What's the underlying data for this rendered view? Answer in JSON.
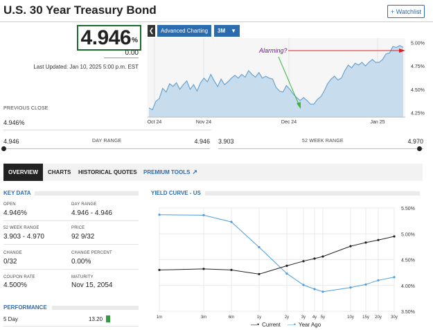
{
  "header": {
    "title": "U.S. 30 Year Treasury Bond",
    "watchlist_label": "+ Watchlist"
  },
  "quote": {
    "price": "4.946",
    "price_unit": "%",
    "change": "0.00",
    "last_updated": "Last Updated: Jan 10, 2025 5:00 p.m. EST"
  },
  "previous_close": {
    "label": "PREVIOUS CLOSE",
    "value": "4.946%"
  },
  "day_range": {
    "label": "DAY RANGE",
    "low": "4.946",
    "high": "4.946",
    "position": 0
  },
  "week52_range": {
    "label": "52 WEEK RANGE",
    "low": "3.903",
    "high": "4.970",
    "position": 0.98
  },
  "chart_controls": {
    "back_icon": "chevron-left-icon",
    "advanced_label": "Advanced Charting",
    "range_label": "3M",
    "dropdown_icon": "caret-down-icon"
  },
  "colors": {
    "accent": "#2b6cb0",
    "price_box_border": "#1a6b2a",
    "area_fill": "#c7dcec",
    "area_line": "#6aa3cf",
    "annotation_red": "#d62020",
    "annotation_green": "#3cb43c",
    "current_series": "#222222",
    "year_ago_series": "#4a9ee0"
  },
  "tabs": [
    {
      "label": "OVERVIEW",
      "active": true
    },
    {
      "label": "CHARTS",
      "active": false
    },
    {
      "label": "HISTORICAL QUOTES",
      "active": false
    },
    {
      "label": "PREMIUM TOOLS",
      "active": false,
      "icon": "external-link-icon"
    }
  ],
  "key_data": {
    "heading": "KEY DATA",
    "items": [
      {
        "label": "OPEN",
        "value": "4.946%"
      },
      {
        "label": "DAY RANGE",
        "value": "4.946 - 4.946"
      },
      {
        "label": "52 WEEK RANGE",
        "value": "3.903 - 4.970"
      },
      {
        "label": "PRICE",
        "value": "92 9/32"
      },
      {
        "label": "CHANGE",
        "value": "0/32"
      },
      {
        "label": "CHANGE PERCENT",
        "value": "0.00%"
      },
      {
        "label": "COUPON RATE",
        "value": "4.500%"
      },
      {
        "label": "MATURITY",
        "value": "Nov 15, 2054"
      }
    ]
  },
  "performance": {
    "heading": "PERFORMANCE",
    "rows": [
      {
        "label": "5 Day",
        "value": "13.20",
        "bar_color": "#2e9e3e"
      }
    ]
  },
  "yield_curve": {
    "heading": "YIELD CURVE - US"
  },
  "chart_data": [
    {
      "type": "area",
      "title": "",
      "x_ticks": [
        "Oct 24",
        "Nov 24",
        "Dec 24",
        "Jan 25"
      ],
      "y_ticks": [
        "4.25%",
        "4.50%",
        "4.75%",
        "5.00%"
      ],
      "ylim": [
        4.2,
        5.05
      ],
      "annotations": [
        {
          "text": "Alarming?",
          "color": "red-arrow-to-peak"
        }
      ],
      "values": [
        4.3,
        4.28,
        4.37,
        4.4,
        4.51,
        4.47,
        4.56,
        4.53,
        4.57,
        4.5,
        4.55,
        4.59,
        4.5,
        4.55,
        4.48,
        4.57,
        4.62,
        4.58,
        4.66,
        4.59,
        4.53,
        4.61,
        4.55,
        4.58,
        4.62,
        4.65,
        4.62,
        4.66,
        4.63,
        4.7,
        4.66,
        4.63,
        4.68,
        4.62,
        4.64,
        4.62,
        4.61,
        4.52,
        4.48,
        4.47,
        4.54,
        4.5,
        4.45,
        4.41,
        4.38,
        4.41,
        4.38,
        4.34,
        4.34,
        4.39,
        4.42,
        4.48,
        4.56,
        4.61,
        4.64,
        4.6,
        4.62,
        4.7,
        4.76,
        4.73,
        4.78,
        4.76,
        4.79,
        4.75,
        4.79,
        4.82,
        4.79,
        4.79,
        4.82,
        4.88,
        4.89,
        4.96,
        4.95,
        4.97,
        4.95
      ]
    },
    {
      "type": "line",
      "title": "",
      "categories": [
        "1m",
        "3m",
        "6m",
        "1y",
        "2y",
        "3y",
        "4y",
        "5y",
        "10y",
        "15y",
        "20y",
        "30y"
      ],
      "y_ticks": [
        "3.50%",
        "4.00%",
        "4.50%",
        "5.00%",
        "5.50%"
      ],
      "ylim": [
        3.5,
        5.5
      ],
      "series": [
        {
          "name": "Current",
          "values": [
            4.3,
            4.32,
            4.3,
            4.22,
            4.38,
            4.47,
            4.52,
            4.56,
            4.76,
            4.83,
            4.88,
            4.95
          ]
        },
        {
          "name": "Year Ago",
          "values": [
            5.37,
            5.36,
            5.23,
            4.74,
            4.23,
            4.01,
            3.93,
            3.88,
            3.96,
            4.02,
            4.1,
            4.16
          ]
        }
      ]
    }
  ]
}
